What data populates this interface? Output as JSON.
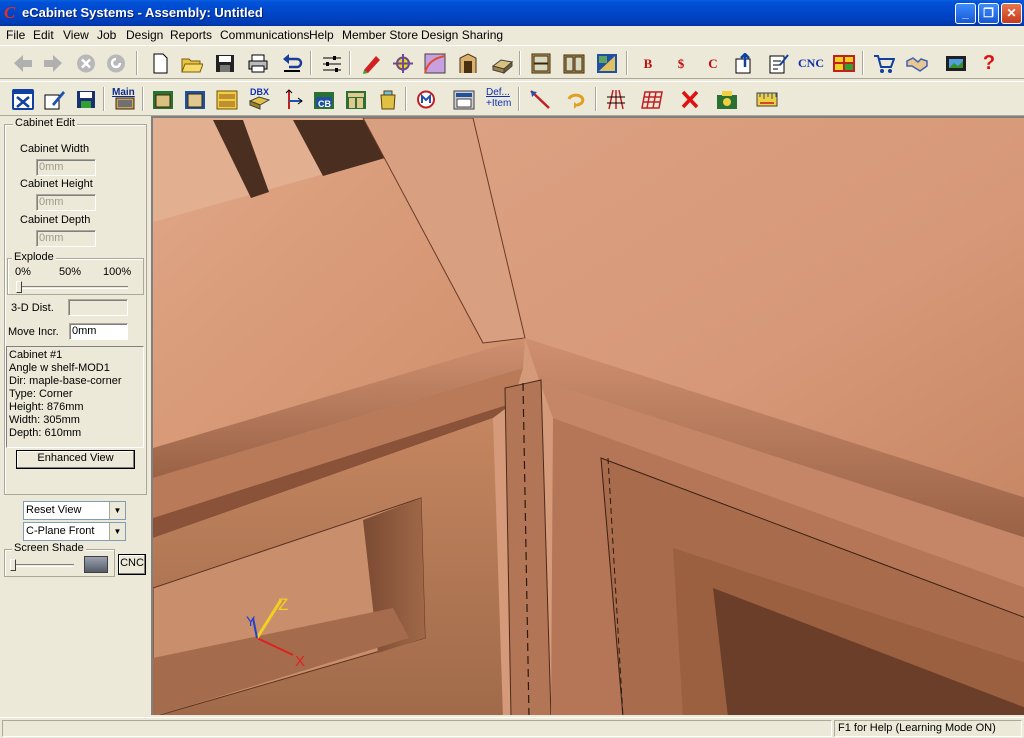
{
  "window": {
    "title": "eCabinet Systems - Assembly: Untitled",
    "app_icon": "C",
    "controls": [
      "_",
      "❐",
      "✕"
    ]
  },
  "menu": [
    "File",
    "Edit",
    "View",
    "Job",
    "Design",
    "Reports",
    "Communications",
    "Help",
    "Member Store",
    "Design Sharing"
  ],
  "toolbar1": {
    "cnc_label": "CNC",
    "help_glyph": "?",
    "report_glyphs": [
      "B",
      "$",
      "C"
    ]
  },
  "toolbar2": {
    "main_label": "Main",
    "dbx_label": "DBX",
    "cb_label": "CB",
    "def_label_top": "Def...",
    "def_label_bottom": "+Item"
  },
  "panel": {
    "cabinet_edit_title": "Cabinet Edit",
    "width_label": "Cabinet Width",
    "width_value": "0mm",
    "height_label": "Cabinet Height",
    "height_value": "0mm",
    "depth_label": "Cabinet Depth",
    "depth_value": "0mm",
    "explode_title": "Explode",
    "explode_ticks": [
      "0%",
      "50%",
      "100%"
    ],
    "explode_value": 0,
    "dist_label": "3-D Dist.",
    "dist_value": "",
    "move_label": "Move Incr.",
    "move_value": "0mm",
    "info": [
      "Cabinet #1",
      "Angle w shelf-MOD1",
      "Dir: maple-base-corner",
      "Type: Corner",
      "Height: 876mm",
      "Width: 305mm",
      "Depth: 610mm"
    ],
    "enhanced_button": "Enhanced View",
    "reset_view": "Reset View",
    "cplane": "C-Plane Front",
    "screen_shade_title": "Screen Shade",
    "screen_shade_value": 0,
    "cnc_button": "CNC"
  },
  "axes": {
    "x": "X",
    "y": "Y",
    "z": "Z"
  },
  "status": {
    "help_text": "F1 for Help (Learning Mode ON)"
  },
  "colors": {
    "title_blue": "#0046C8",
    "wood": "#D9A07E",
    "wood_dark": "#8A5A3E",
    "close_red": "#C53A1C"
  }
}
